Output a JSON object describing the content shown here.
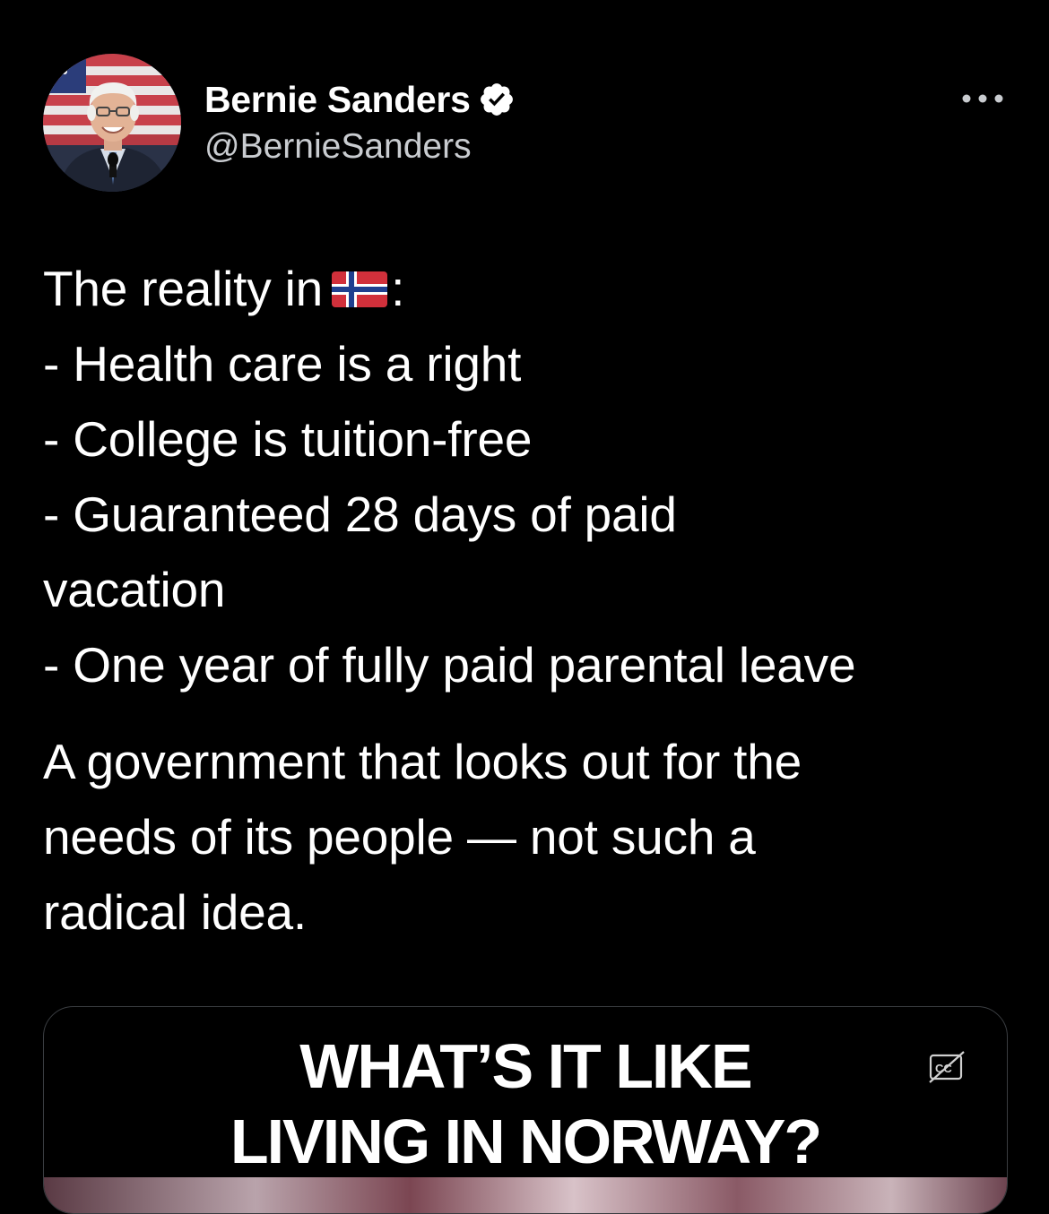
{
  "author": {
    "display_name": "Bernie Sanders",
    "handle": "@BernieSanders",
    "verified": true,
    "avatar_icon": "profile-photo-icon"
  },
  "menu": {
    "more_icon": "more-options-icon"
  },
  "tweet": {
    "line1_prefix": "The reality in",
    "line1_flag": "norway-flag-emoji",
    "line1_suffix": ":",
    "bullets": [
      "- Health care is a right",
      "- College is tuition-free",
      "- Guaranteed 28 days of paid",
      "vacation",
      "- One year of fully paid parental leave"
    ],
    "closing_lines": [
      "A government that looks out for the",
      "needs of its people — not such a",
      "radical idea."
    ]
  },
  "media": {
    "title_line1": "WHAT’S IT LIKE",
    "title_line2": "LIVING IN NORWAY?",
    "captions_icon": "closed-captions-icon"
  },
  "colors": {
    "background": "#000000",
    "text": "#ffffff",
    "secondary_text": "#c9ccd0",
    "verified": "#ffffff",
    "border": "#3a3d41"
  }
}
